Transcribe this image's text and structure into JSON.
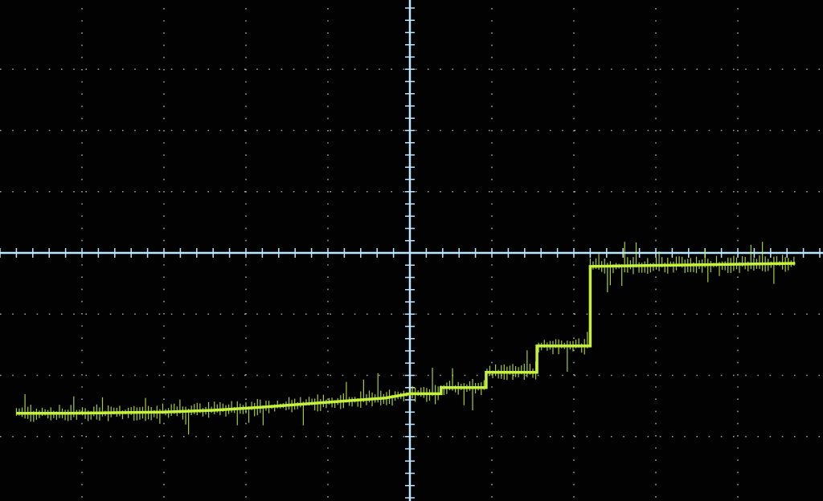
{
  "chart_data": {
    "type": "line",
    "title": "",
    "xlabel": "",
    "ylabel": "",
    "grid": true,
    "xlim": [
      -5,
      5
    ],
    "ylim": [
      -4,
      4
    ],
    "trace_color": "#c6f13c",
    "grid_color": "#c8c8c8",
    "axis_color": "#bfe6ff",
    "series": [
      {
        "points": [
          [
            -4.8,
            -2.62
          ],
          [
            -4.2,
            -2.62
          ],
          [
            -3.6,
            -2.61
          ],
          [
            -3.0,
            -2.6
          ],
          [
            -2.4,
            -2.57
          ],
          [
            -1.8,
            -2.52
          ],
          [
            -1.3,
            -2.47
          ],
          [
            -0.8,
            -2.42
          ],
          [
            -0.3,
            -2.37
          ],
          [
            0.0,
            -2.3
          ],
          [
            0.38,
            -2.3
          ],
          [
            0.38,
            -2.2
          ],
          [
            0.93,
            -2.2
          ],
          [
            0.93,
            -1.95
          ],
          [
            1.55,
            -1.95
          ],
          [
            1.55,
            -1.52
          ],
          [
            2.2,
            -1.52
          ],
          [
            2.2,
            -0.22
          ],
          [
            4.7,
            -0.17
          ]
        ]
      }
    ]
  }
}
